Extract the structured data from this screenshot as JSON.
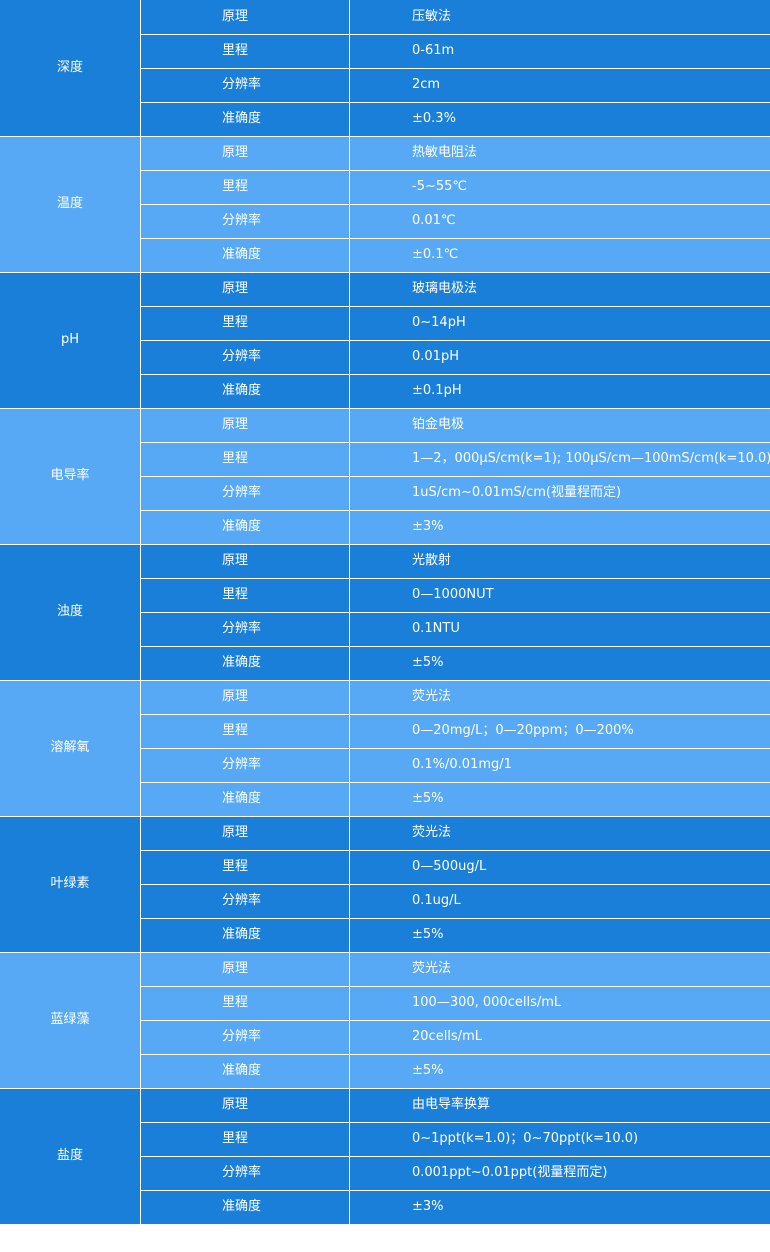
{
  "colors": {
    "dark": "#1a7fd9",
    "light": "#57a9f5",
    "text": "#ffffff"
  },
  "groups": [
    {
      "name": "深度",
      "theme": "dark",
      "rows": [
        {
          "attr": "原理",
          "value": "压敏法"
        },
        {
          "attr": "里程",
          "value": "0-61m"
        },
        {
          "attr": "分辨率",
          "value": "2cm"
        },
        {
          "attr": "准确度",
          "value": "±0.3%"
        }
      ]
    },
    {
      "name": "温度",
      "theme": "light",
      "rows": [
        {
          "attr": "原理",
          "value": "热敏电阻法"
        },
        {
          "attr": "里程",
          "value": "-5~55℃"
        },
        {
          "attr": "分辨率",
          "value": "0.01℃"
        },
        {
          "attr": "准确度",
          "value": "±0.1℃"
        }
      ]
    },
    {
      "name": "pH",
      "theme": "dark",
      "rows": [
        {
          "attr": "原理",
          "value": "玻璃电极法"
        },
        {
          "attr": "里程",
          "value": "0~14pH"
        },
        {
          "attr": "分辨率",
          "value": "0.01pH"
        },
        {
          "attr": "准确度",
          "value": "±0.1pH"
        }
      ]
    },
    {
      "name": "电导率",
      "theme": "light",
      "rows": [
        {
          "attr": "原理",
          "value": "铂金电极"
        },
        {
          "attr": "里程",
          "value": "1—2，000μS/cm(k=1); 100μS/cm—100mS/cm(k=10.0)"
        },
        {
          "attr": "分辨率",
          "value": "1uS/cm~0.01mS/cm(视量程而定)"
        },
        {
          "attr": "准确度",
          "value": "±3%"
        }
      ]
    },
    {
      "name": "浊度",
      "theme": "dark",
      "rows": [
        {
          "attr": "原理",
          "value": "光散射"
        },
        {
          "attr": "里程",
          "value": "0—1000NUT"
        },
        {
          "attr": "分辨率",
          "value": "0.1NTU"
        },
        {
          "attr": "准确度",
          "value": "±5%"
        }
      ]
    },
    {
      "name": "溶解氧",
      "theme": "light",
      "rows": [
        {
          "attr": "原理",
          "value": "荧光法"
        },
        {
          "attr": "里程",
          "value": "0—20mg/L；0—20ppm；0—200%"
        },
        {
          "attr": "分辨率",
          "value": "0.1%/0.01mg/1"
        },
        {
          "attr": "准确度",
          "value": "±5%"
        }
      ]
    },
    {
      "name": "叶绿素",
      "theme": "dark",
      "rows": [
        {
          "attr": "原理",
          "value": "荧光法"
        },
        {
          "attr": "里程",
          "value": "0—500ug/L"
        },
        {
          "attr": "分辨率",
          "value": "0.1ug/L"
        },
        {
          "attr": "准确度",
          "value": "±5%"
        }
      ]
    },
    {
      "name": "蓝绿藻",
      "theme": "light",
      "rows": [
        {
          "attr": "原理",
          "value": "荧光法"
        },
        {
          "attr": "里程",
          "value": "100—300, 000cells/mL"
        },
        {
          "attr": "分辨率",
          "value": "20cells/mL"
        },
        {
          "attr": "准确度",
          "value": "±5%"
        }
      ]
    },
    {
      "name": "盐度",
      "theme": "dark",
      "rows": [
        {
          "attr": "原理",
          "value": "由电导率换算"
        },
        {
          "attr": "里程",
          "value": "0~1ppt(k=1.0)；0~70ppt(k=10.0)"
        },
        {
          "attr": "分辨率",
          "value": "0.001ppt~0.01ppt(视量程而定)"
        },
        {
          "attr": "准确度",
          "value": "±3%"
        }
      ]
    }
  ]
}
